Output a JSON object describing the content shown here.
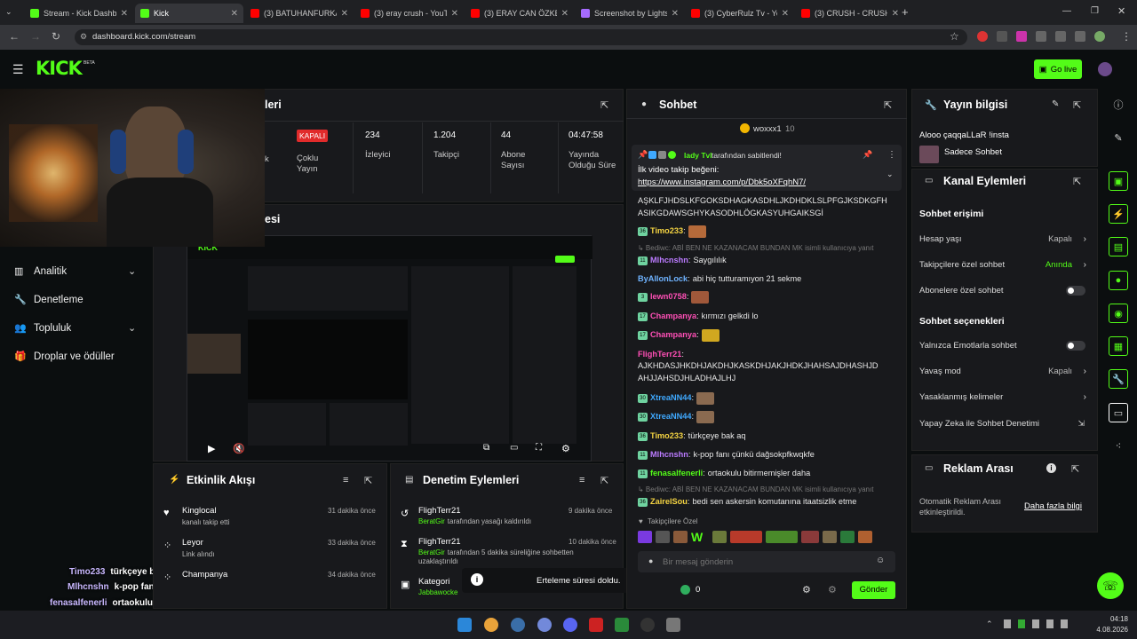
{
  "browser": {
    "tabs": [
      {
        "title": "Stream - Kick Dashbo",
        "color": "#53fc18",
        "active": false
      },
      {
        "title": "Kick",
        "color": "#53fc18",
        "active": true
      },
      {
        "title": "(3) BATUHANFURKAN",
        "color": "#ff0000",
        "active": false
      },
      {
        "title": "(3) eray crush - YouTu",
        "color": "#ff0000",
        "active": false
      },
      {
        "title": "(3) ERAY CAN ÖZKEN",
        "color": "#ff0000",
        "active": false
      },
      {
        "title": "Screenshot by Lightsh",
        "color": "#a66bff",
        "active": false
      },
      {
        "title": "(3) CyberRulz Tv - You",
        "color": "#ff0000",
        "active": false
      },
      {
        "title": "(3) CRUSH - CRUSHI",
        "color": "#ff0000",
        "active": false
      }
    ],
    "url": "dashboard.kick.com/stream"
  },
  "header": {
    "logo": "KICK",
    "beta": "BETA",
    "go_live": "Go live"
  },
  "stream_panel": {
    "title_tail": "leri",
    "status": "KAPALI",
    "status_label": "Çoklu Yayın",
    "k_label": "k",
    "viewers_value": "234",
    "viewers_label": "İzleyici",
    "followers_value": "1.204",
    "followers_label": "Takipçi",
    "subs_value": "44",
    "subs_label": "Abone Sayısı",
    "uptime_value": "04:47:58",
    "uptime_label": "Yayında Olduğu Süre",
    "preview_tail": "esi"
  },
  "sidebar": {
    "items": [
      {
        "label": "Analitik",
        "icon": "chart-icon",
        "chev": true
      },
      {
        "label": "Denetleme",
        "icon": "wrench-icon",
        "chev": false
      },
      {
        "label": "Topluluk",
        "icon": "users-icon",
        "chev": true
      },
      {
        "label": "Droplar ve ödüller",
        "icon": "gift-icon",
        "chev": false
      }
    ]
  },
  "overlay_chat": [
    {
      "user": "Timo233",
      "text": "türkçeye bak aq"
    },
    {
      "user": "Mlhcnshn",
      "text": "k-pop fanı çünkü dağsokpfkwqkfe"
    },
    {
      "user": "fenasalfenerli",
      "text": "ortaokulu bitirmemişler daha"
    }
  ],
  "activity": {
    "title": "Etkinlik Akışı",
    "items": [
      {
        "name": "Kinglocal",
        "desc": "kanalı takip etti",
        "time": "31 dakika önce",
        "icon": "heart-icon"
      },
      {
        "name": "Leyor",
        "desc": "Link alındı",
        "time": "33 dakika önce",
        "icon": "drop-icon"
      },
      {
        "name": "Champanya",
        "desc": "",
        "time": "34 dakika önce",
        "icon": "drop-icon"
      }
    ]
  },
  "moderation": {
    "title": "Denetim Eylemleri",
    "items": [
      {
        "name": "FlighTerr21",
        "by": "BeratGir",
        "desc": "tarafından yasağı kaldırıldı",
        "time": "9 dakika önce",
        "icon": "undo-icon"
      },
      {
        "name": "FlighTerr21",
        "by": "BeratGir",
        "desc": "tarafından 5 dakika süreliğine sohbetten uzaklaştırıldı",
        "time": "10 dakika önce",
        "icon": "hourglass-icon"
      },
      {
        "name": "Kategori",
        "by": "Jabbawocke",
        "desc": "",
        "time": "",
        "icon": "category-icon"
      }
    ]
  },
  "toast": {
    "text": "Erteleme süresi doldu."
  },
  "chat": {
    "title": "Sohbet",
    "top_gifter": "woxxx1",
    "top_gifter_count": "10",
    "pinned": {
      "by_user": "lady Tvl",
      "by_suffix": "tarafından sabitlendi!",
      "line1": "İlk video takip beğeni:",
      "link": "https://www.instagram.com/p/Dbk5oXFqhN7/"
    },
    "messages": [
      {
        "badge": "",
        "user": "",
        "ucolor": "#fff",
        "text": "AŞKLFJHDSLKFGOKSDHAGKASDHLJKDHDKLSLPFGJKSDKGFH",
        "emote": ""
      },
      {
        "badge": "",
        "user": "",
        "ucolor": "#fff",
        "text": "ASIKGDAWSGHYKASODHLÖGKASYUHGAIKSGİ",
        "emote": ""
      },
      {
        "badge": "36",
        "user": "Timo233",
        "ucolor": "#f5d442",
        "text": "",
        "emote": "#b56a3a"
      },
      {
        "badge": "",
        "user": "",
        "ucolor": "#777",
        "text": "↳ Bediwc: ABİ BEN NE KAZANACAM BUNDAN MK isimli kullanıcıya yanıt",
        "emote": ""
      },
      {
        "badge": "11",
        "user": "Mlhcnshn",
        "ucolor": "#bb7bff",
        "text": "Saygılılık",
        "emote": ""
      },
      {
        "badge": "",
        "user": "ByAllonLock",
        "ucolor": "#6fb3ff",
        "text": "abi hiç tutturamıyon 21 sekme",
        "emote": ""
      },
      {
        "badge": "3",
        "user": "lewn0758",
        "ucolor": "#ff4fb6",
        "text": "",
        "emote": "#a0583a"
      },
      {
        "badge": "17",
        "user": "Champanya",
        "ucolor": "#ff4fb6",
        "text": "kırmızı gelkdi lo",
        "emote": ""
      },
      {
        "badge": "17",
        "user": "Champanya",
        "ucolor": "#ff4fb6",
        "text": "",
        "emote": "#d1a820"
      },
      {
        "badge": "",
        "user": "FlighTerr21",
        "ucolor": "#ff4fb6",
        "text": "",
        "emote": ""
      },
      {
        "badge": "",
        "user": "",
        "ucolor": "#fff",
        "text": "AJKHDASJHKDHJAKDHJKASKDHJAKJHDKJHAHSAJDHASHJD",
        "emote": ""
      },
      {
        "badge": "",
        "user": "",
        "ucolor": "#fff",
        "text": "AHJJAHSDJHLADHAJLHJ",
        "emote": ""
      },
      {
        "badge": "30",
        "user": "XtreaNN44",
        "ucolor": "#3fa9ff",
        "text": "",
        "emote": "#8a6a50"
      },
      {
        "badge": "30",
        "user": "XtreaNN44",
        "ucolor": "#3fa9ff",
        "text": "",
        "emote": "#8a6a50"
      },
      {
        "badge": "36",
        "user": "Timo233",
        "ucolor": "#f5d442",
        "text": "türkçeye bak aq",
        "emote": ""
      },
      {
        "badge": "11",
        "user": "Mlhcnshn",
        "ucolor": "#bb7bff",
        "text": "k-pop fanı çünkü dağsokpfkwqkfe",
        "emote": ""
      },
      {
        "badge": "11",
        "user": "fenasalfenerli",
        "ucolor": "#53fc18",
        "text": "ortaokulu bitirmemişler daha",
        "emote": ""
      },
      {
        "badge": "",
        "user": "",
        "ucolor": "#777",
        "text": "↳ Bediwc: ABİ BEN NE KAZANACAM BUNDAN MK isimli kullanıcıya yanıt",
        "emote": ""
      },
      {
        "badge": "36",
        "user": "ZairelSou",
        "ucolor": "#f5d442",
        "text": "bedi sen askersin komutanına itaatsizlik etme",
        "emote": ""
      }
    ],
    "followers_only": "Takipçilere Özel",
    "input_placeholder": "Bir mesaj gönderin",
    "points": "0",
    "send": "Gönder"
  },
  "stream_info": {
    "title": "Yayın bilgisi",
    "stream_title": "Alooo çaqqaLLaR !insta",
    "chat_mode": "Sadece Sohbet"
  },
  "channel_actions": {
    "title": "Kanal Eylemleri",
    "chat_access": "Sohbet erişimi",
    "account_age": "Hesap yaşı",
    "account_age_value": "Kapalı",
    "followers_chat": "Takipçilere özel sohbet",
    "followers_chat_value": "Anında",
    "subs_chat": "Abonelere özel sohbet",
    "chat_options": "Sohbet seçenekleri",
    "emotes_only": "Yalnızca Emotlarla sohbet",
    "slow_mode": "Yavaş mod",
    "slow_mode_value": "Kapalı",
    "banned_words": "Yasaklanmış kelimeler",
    "ai_mod": "Yapay Zeka ile Sohbet Denetimi"
  },
  "ad_break": {
    "title": "Reklam Arası",
    "desc": "Otomatik Reklam Arası etkinleştirildi.",
    "link": "Daha fazla bilgi"
  },
  "taskbar": {
    "time": "04:18",
    "date": "4.08.2026"
  }
}
